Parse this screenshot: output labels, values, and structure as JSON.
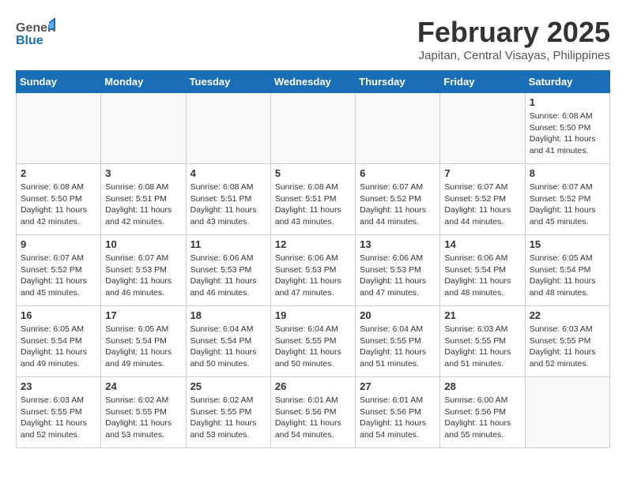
{
  "header": {
    "logo_general": "General",
    "logo_blue": "Blue",
    "month_title": "February 2025",
    "location": "Japitan, Central Visayas, Philippines"
  },
  "days_of_week": [
    "Sunday",
    "Monday",
    "Tuesday",
    "Wednesday",
    "Thursday",
    "Friday",
    "Saturday"
  ],
  "weeks": [
    [
      {
        "day": "",
        "info": ""
      },
      {
        "day": "",
        "info": ""
      },
      {
        "day": "",
        "info": ""
      },
      {
        "day": "",
        "info": ""
      },
      {
        "day": "",
        "info": ""
      },
      {
        "day": "",
        "info": ""
      },
      {
        "day": "1",
        "info": "Sunrise: 6:08 AM\nSunset: 5:50 PM\nDaylight: 11 hours\nand 41 minutes."
      }
    ],
    [
      {
        "day": "2",
        "info": "Sunrise: 6:08 AM\nSunset: 5:50 PM\nDaylight: 11 hours\nand 42 minutes."
      },
      {
        "day": "3",
        "info": "Sunrise: 6:08 AM\nSunset: 5:51 PM\nDaylight: 11 hours\nand 42 minutes."
      },
      {
        "day": "4",
        "info": "Sunrise: 6:08 AM\nSunset: 5:51 PM\nDaylight: 11 hours\nand 43 minutes."
      },
      {
        "day": "5",
        "info": "Sunrise: 6:08 AM\nSunset: 5:51 PM\nDaylight: 11 hours\nand 43 minutes."
      },
      {
        "day": "6",
        "info": "Sunrise: 6:07 AM\nSunset: 5:52 PM\nDaylight: 11 hours\nand 44 minutes."
      },
      {
        "day": "7",
        "info": "Sunrise: 6:07 AM\nSunset: 5:52 PM\nDaylight: 11 hours\nand 44 minutes."
      },
      {
        "day": "8",
        "info": "Sunrise: 6:07 AM\nSunset: 5:52 PM\nDaylight: 11 hours\nand 45 minutes."
      }
    ],
    [
      {
        "day": "9",
        "info": "Sunrise: 6:07 AM\nSunset: 5:52 PM\nDaylight: 11 hours\nand 45 minutes."
      },
      {
        "day": "10",
        "info": "Sunrise: 6:07 AM\nSunset: 5:53 PM\nDaylight: 11 hours\nand 46 minutes."
      },
      {
        "day": "11",
        "info": "Sunrise: 6:06 AM\nSunset: 5:53 PM\nDaylight: 11 hours\nand 46 minutes."
      },
      {
        "day": "12",
        "info": "Sunrise: 6:06 AM\nSunset: 5:53 PM\nDaylight: 11 hours\nand 47 minutes."
      },
      {
        "day": "13",
        "info": "Sunrise: 6:06 AM\nSunset: 5:53 PM\nDaylight: 11 hours\nand 47 minutes."
      },
      {
        "day": "14",
        "info": "Sunrise: 6:06 AM\nSunset: 5:54 PM\nDaylight: 11 hours\nand 48 minutes."
      },
      {
        "day": "15",
        "info": "Sunrise: 6:05 AM\nSunset: 5:54 PM\nDaylight: 11 hours\nand 48 minutes."
      }
    ],
    [
      {
        "day": "16",
        "info": "Sunrise: 6:05 AM\nSunset: 5:54 PM\nDaylight: 11 hours\nand 49 minutes."
      },
      {
        "day": "17",
        "info": "Sunrise: 6:05 AM\nSunset: 5:54 PM\nDaylight: 11 hours\nand 49 minutes."
      },
      {
        "day": "18",
        "info": "Sunrise: 6:04 AM\nSunset: 5:54 PM\nDaylight: 11 hours\nand 50 minutes."
      },
      {
        "day": "19",
        "info": "Sunrise: 6:04 AM\nSunset: 5:55 PM\nDaylight: 11 hours\nand 50 minutes."
      },
      {
        "day": "20",
        "info": "Sunrise: 6:04 AM\nSunset: 5:55 PM\nDaylight: 11 hours\nand 51 minutes."
      },
      {
        "day": "21",
        "info": "Sunrise: 6:03 AM\nSunset: 5:55 PM\nDaylight: 11 hours\nand 51 minutes."
      },
      {
        "day": "22",
        "info": "Sunrise: 6:03 AM\nSunset: 5:55 PM\nDaylight: 11 hours\nand 52 minutes."
      }
    ],
    [
      {
        "day": "23",
        "info": "Sunrise: 6:03 AM\nSunset: 5:55 PM\nDaylight: 11 hours\nand 52 minutes."
      },
      {
        "day": "24",
        "info": "Sunrise: 6:02 AM\nSunset: 5:55 PM\nDaylight: 11 hours\nand 53 minutes."
      },
      {
        "day": "25",
        "info": "Sunrise: 6:02 AM\nSunset: 5:55 PM\nDaylight: 11 hours\nand 53 minutes."
      },
      {
        "day": "26",
        "info": "Sunrise: 6:01 AM\nSunset: 5:56 PM\nDaylight: 11 hours\nand 54 minutes."
      },
      {
        "day": "27",
        "info": "Sunrise: 6:01 AM\nSunset: 5:56 PM\nDaylight: 11 hours\nand 54 minutes."
      },
      {
        "day": "28",
        "info": "Sunrise: 6:00 AM\nSunset: 5:56 PM\nDaylight: 11 hours\nand 55 minutes."
      },
      {
        "day": "",
        "info": ""
      }
    ]
  ]
}
